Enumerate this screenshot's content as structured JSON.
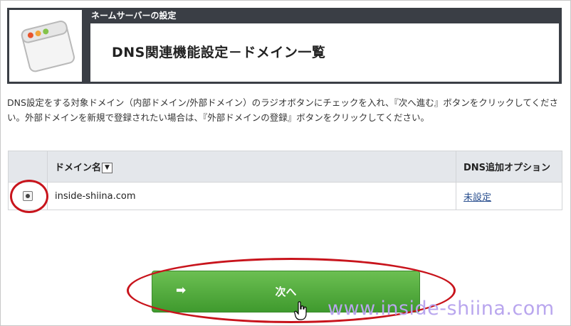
{
  "header": {
    "section_title": "ネームサーバーの設定",
    "page_title": "DNS関連機能設定－ドメイン一覧"
  },
  "description": "DNS設定をする対象ドメイン（内部ドメイン/外部ドメイン）のラジオボタンにチェックを入れ、『次へ進む』ボタンをクリックしてください。外部ドメインを新規で登録されたい場合は、『外部ドメインの登録』ボタンをクリックしてください。",
  "table": {
    "headers": {
      "domain": "ドメイン名",
      "sort_icon": "▼",
      "option": "DNS追加オプション"
    },
    "rows": [
      {
        "selected": true,
        "domain": "inside-shiina.com",
        "option": "未設定"
      }
    ]
  },
  "next_button": {
    "label": "次へ",
    "arrow": "➡"
  },
  "watermark": "www.inside-shiina.com",
  "colors": {
    "header_bg": "#3a3e45",
    "button_green": "#4fa83a",
    "annotation_red": "#c8141c",
    "watermark": "#b9a6ee"
  }
}
